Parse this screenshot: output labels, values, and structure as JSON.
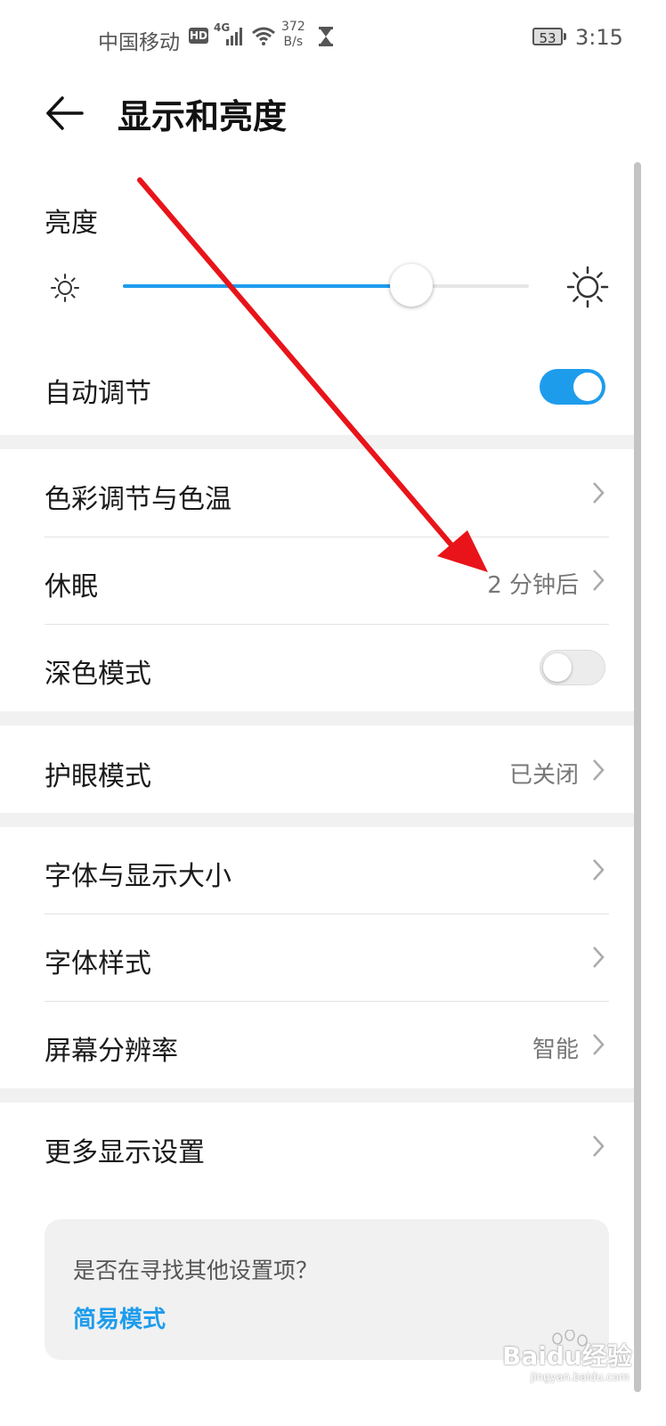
{
  "status_bar": {
    "carrier": "中国移动",
    "hd_badge": "HD",
    "network": "4G",
    "speed_value": "372",
    "speed_unit": "B/s",
    "battery": "53",
    "time": "3:15"
  },
  "header": {
    "title": "显示和亮度",
    "back_icon": "arrow-left-icon"
  },
  "brightness": {
    "label": "亮度",
    "level": 0.71,
    "min_icon": "sun-small-icon",
    "max_icon": "sun-large-icon"
  },
  "auto_adjust": {
    "label": "自动调节",
    "enabled": true
  },
  "rows": {
    "color_temp": {
      "label": "色彩调节与色温"
    },
    "sleep": {
      "label": "休眠",
      "value": "2 分钟后"
    },
    "dark_mode": {
      "label": "深色模式",
      "enabled": false
    },
    "eye_comfort": {
      "label": "护眼模式",
      "value": "已关闭"
    },
    "font_size": {
      "label": "字体与显示大小"
    },
    "font_style": {
      "label": "字体样式"
    },
    "resolution": {
      "label": "屏幕分辨率",
      "value": "智能"
    },
    "more_display": {
      "label": "更多显示设置"
    }
  },
  "suggestion": {
    "question": "是否在寻找其他设置项？",
    "link": "简易模式"
  },
  "watermark": {
    "text": "Baidu经验",
    "sub": "jingyan.baidu.com"
  },
  "colors": {
    "accent": "#1e9cec",
    "annotation_arrow": "#e8141a",
    "section_gap": "#f1f1f1"
  }
}
